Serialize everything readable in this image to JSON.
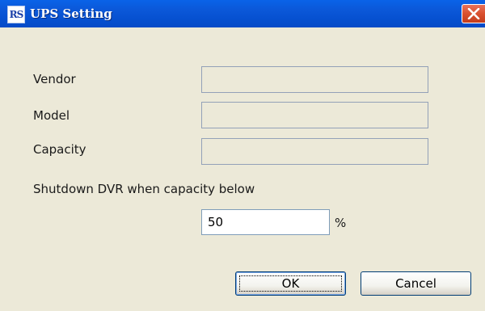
{
  "window": {
    "title": "UPS Setting",
    "icon_text": "RS",
    "close_icon": "close-icon"
  },
  "form": {
    "vendor_label": "Vendor",
    "vendor_value": "",
    "model_label": "Model",
    "model_value": "",
    "capacity_label": "Capacity",
    "capacity_value": "",
    "shutdown_label": "Shutdown DVR when capacity below",
    "shutdown_value": "50",
    "percent_unit": "%"
  },
  "buttons": {
    "ok": "OK",
    "cancel": "Cancel"
  },
  "colors": {
    "titlebar": "#0650d0",
    "dialog_background": "#ece9d8",
    "close_button": "#d9502f"
  }
}
